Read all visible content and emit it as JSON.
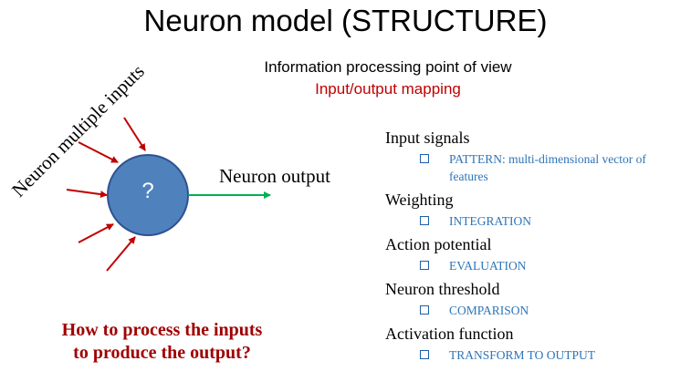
{
  "slide": {
    "title": "Neuron model (STRUCTURE)",
    "subtitle_line1": "Information processing point of view",
    "subtitle_line2": "Input/output mapping",
    "inputs_label": "Neuron multiple inputs",
    "neuron_symbol": "?",
    "output_label": "Neuron output",
    "question": "How to process the inputs to produce the output?"
  },
  "list": [
    {
      "heading": "Input signals",
      "item": "PATTERN: multi-dimensional vector of features"
    },
    {
      "heading": "Weighting",
      "item": "INTEGRATION"
    },
    {
      "heading": "Action potential",
      "item": "EVALUATION"
    },
    {
      "heading": "Neuron threshold",
      "item": "COMPARISON"
    },
    {
      "heading": "Activation function",
      "item": "TRANSFORM TO OUTPUT"
    }
  ],
  "colors": {
    "neuron_fill": "#4f81bd",
    "neuron_stroke": "#2f528f",
    "input_arrow": "#c00000",
    "output_arrow": "#00b050",
    "question_text": "#a00000",
    "list_item_text": "#2e75b6"
  },
  "icons": {
    "list_bullet": "square-bullet-icon"
  }
}
